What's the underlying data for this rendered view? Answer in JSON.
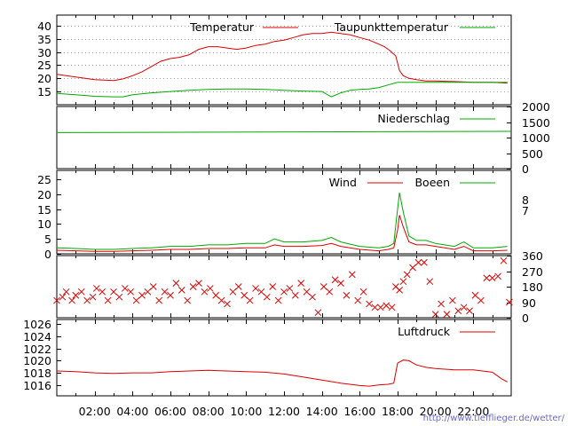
{
  "credit": "http://www.tiefflieger.de/wetter/",
  "time_ticks": [
    "02:00",
    "04:00",
    "06:00",
    "08:00",
    "10:00",
    "12:00",
    "14:00",
    "16:00",
    "18:00",
    "20:00",
    "22:00"
  ],
  "colors": {
    "red": "#dd0000",
    "green": "#00aa00",
    "grid": "#a0a0a0"
  },
  "chart_data": [
    {
      "type": "line",
      "panel": "temperature",
      "ylim": [
        10,
        44
      ],
      "yticks": [
        15,
        20,
        25,
        30,
        35,
        40
      ],
      "grid": true,
      "legend_position": "top",
      "series": [
        {
          "name": "Temperatur",
          "color": "#dd0000",
          "x": [
            0,
            1,
            1.5,
            2,
            3,
            3.5,
            4,
            4.5,
            5,
            5.5,
            6,
            6.5,
            7,
            7.5,
            8,
            8.5,
            9,
            9.5,
            10,
            10.5,
            11,
            11.5,
            12,
            12.5,
            13,
            13.5,
            14,
            14.5,
            15,
            15.5,
            16,
            16.5,
            17,
            17.3,
            17.6,
            17.9,
            18.1,
            18.3,
            18.6,
            19,
            19.5,
            20,
            21,
            22,
            23,
            23.8
          ],
          "values": [
            21.5,
            20.5,
            20,
            19.5,
            19.2,
            19.8,
            21,
            22.5,
            24.5,
            26.5,
            27.5,
            28,
            29,
            31,
            32,
            32,
            31.5,
            31,
            31.5,
            32.5,
            33,
            34,
            34.5,
            35.5,
            36.5,
            37,
            37,
            37.5,
            37,
            36.5,
            35.5,
            34.5,
            33,
            32,
            30.5,
            28.5,
            23,
            21,
            20,
            19.5,
            19,
            19,
            18.8,
            18.5,
            18.5,
            18.2
          ]
        },
        {
          "name": "Taupunkttemperatur",
          "color": "#00aa00",
          "x": [
            0,
            1,
            2,
            3,
            3.5,
            4,
            5,
            6,
            7,
            8,
            9,
            10,
            11,
            12,
            13,
            14,
            14.5,
            15,
            15.5,
            16,
            16.5,
            17,
            17.5,
            18,
            18.5,
            19,
            20,
            21,
            22,
            23,
            23.8
          ],
          "values": [
            14.3,
            13.8,
            13.2,
            13,
            13,
            13.8,
            14.5,
            15,
            15.5,
            15.8,
            16,
            16,
            15.8,
            15.5,
            15.2,
            15,
            13,
            14.5,
            15.5,
            15.8,
            16,
            16.5,
            17.5,
            18.5,
            18.5,
            18.5,
            18.5,
            18.5,
            18.5,
            18.5,
            18.5
          ]
        }
      ]
    },
    {
      "type": "line",
      "panel": "precipitation",
      "ylim": [
        0,
        2000
      ],
      "yticks": [
        0,
        500,
        1000,
        1500,
        2000
      ],
      "legend_position": "top-right",
      "series": [
        {
          "name": "Niederschlag",
          "color": "#00aa00",
          "x": [
            0,
            24
          ],
          "values": [
            1160,
            1200
          ]
        }
      ]
    },
    {
      "type": "line",
      "panel": "wind",
      "ylim": [
        0,
        28
      ],
      "yticks": [
        0,
        5,
        10,
        15,
        20,
        25
      ],
      "right_labels": [
        "8",
        "7"
      ],
      "legend_position": "top-right",
      "series": [
        {
          "name": "Wind",
          "color": "#dd0000",
          "x": [
            0,
            1,
            2,
            3,
            4,
            5,
            6,
            7,
            8,
            9,
            10,
            11,
            11.5,
            12,
            13,
            14,
            14.5,
            15,
            16,
            17,
            17.5,
            17.8,
            18,
            18.1,
            18.3,
            18.6,
            19,
            19.5,
            20,
            21,
            21.5,
            22,
            23,
            23.8
          ],
          "values": [
            1.2,
            1,
            0.8,
            0.8,
            1,
            1.2,
            1.5,
            1.5,
            1.8,
            1.8,
            2,
            2,
            3,
            2.5,
            2.5,
            2.8,
            3.5,
            2.5,
            1.5,
            1,
            1.5,
            2,
            8,
            13,
            9,
            4,
            3,
            3,
            2.5,
            1.5,
            2.5,
            1,
            1,
            1.2
          ]
        },
        {
          "name": "Boeen",
          "color": "#00aa00",
          "x": [
            0,
            1,
            2,
            3,
            4,
            5,
            6,
            7,
            8,
            9,
            10,
            11,
            11.5,
            12,
            13,
            14,
            14.5,
            15,
            16,
            17,
            17.5,
            17.8,
            18,
            18.1,
            18.3,
            18.6,
            19,
            19.5,
            20,
            21,
            21.5,
            22,
            23,
            23.8
          ],
          "values": [
            2,
            1.8,
            1.5,
            1.5,
            1.8,
            2,
            2.5,
            2.5,
            3,
            3,
            3.5,
            3.5,
            5,
            4,
            4,
            4.5,
            5.5,
            4,
            2.5,
            2,
            2.5,
            3.5,
            15,
            20.5,
            14,
            6,
            4.5,
            4.5,
            3.5,
            2.5,
            4,
            2,
            2,
            2.5
          ]
        }
      ]
    },
    {
      "type": "scatter",
      "panel": "wind_direction",
      "ylim": [
        0,
        360
      ],
      "yticks": [
        0,
        90,
        180,
        270,
        360
      ],
      "marker": "x",
      "series": [
        {
          "color": "#dd0000",
          "x": [
            0,
            0.3,
            0.5,
            0.8,
            1,
            1.3,
            1.6,
            1.9,
            2.1,
            2.4,
            2.7,
            3,
            3.3,
            3.6,
            3.9,
            4.2,
            4.5,
            4.8,
            5.1,
            5.4,
            5.7,
            6,
            6.3,
            6.6,
            6.9,
            7.2,
            7.5,
            7.8,
            8.1,
            8.4,
            8.7,
            9,
            9.3,
            9.6,
            9.9,
            10.2,
            10.5,
            10.8,
            11.1,
            11.4,
            11.7,
            12,
            12.3,
            12.6,
            12.9,
            13.2,
            13.5,
            13.8,
            14.1,
            14.4,
            14.7,
            15,
            15.3,
            15.6,
            15.9,
            16.2,
            16.5,
            16.8,
            17.1,
            17.4,
            17.7,
            17.9,
            18.1,
            18.3,
            18.5,
            18.8,
            19.1,
            19.4,
            19.7,
            20,
            20.3,
            20.6,
            20.9,
            21.2,
            21.5,
            21.8,
            22.1,
            22.4,
            22.7,
            23,
            23.3,
            23.6,
            23.9
          ],
          "values": [
            100,
            120,
            150,
            100,
            130,
            150,
            100,
            120,
            170,
            150,
            100,
            150,
            120,
            170,
            150,
            100,
            130,
            150,
            180,
            100,
            150,
            130,
            200,
            160,
            100,
            180,
            200,
            150,
            170,
            130,
            100,
            80,
            150,
            180,
            130,
            100,
            170,
            150,
            120,
            180,
            100,
            150,
            170,
            130,
            200,
            150,
            120,
            30,
            180,
            150,
            220,
            200,
            130,
            250,
            100,
            150,
            80,
            60,
            60,
            70,
            60,
            180,
            160,
            210,
            250,
            290,
            320,
            320,
            210,
            20,
            80,
            20,
            100,
            40,
            60,
            40,
            130,
            100,
            230,
            230,
            240,
            330,
            90
          ]
        }
      ]
    },
    {
      "type": "line",
      "panel": "pressure",
      "ylim": [
        1014.2,
        1026.8
      ],
      "yticks": [
        1016,
        1018,
        1020,
        1022,
        1024,
        1026
      ],
      "legend_position": "top-right",
      "series": [
        {
          "name": "Luftdruck",
          "color": "#dd0000",
          "x": [
            0,
            1,
            2,
            3,
            4,
            5,
            6,
            7,
            8,
            9,
            10,
            11,
            12,
            13,
            14,
            15,
            16,
            16.5,
            17,
            17.5,
            17.8,
            18,
            18.3,
            18.6,
            19,
            19.5,
            20,
            20.5,
            21,
            22,
            23,
            23.5,
            23.8
          ],
          "values": [
            1018.3,
            1018.2,
            1018,
            1017.9,
            1018,
            1018,
            1018.2,
            1018.3,
            1018.4,
            1018.3,
            1018.2,
            1018.1,
            1017.8,
            1017.3,
            1016.8,
            1016.3,
            1015.9,
            1015.8,
            1016.0,
            1016.1,
            1016.3,
            1019.6,
            1020.1,
            1020.0,
            1019.3,
            1018.9,
            1018.7,
            1018.6,
            1018.5,
            1018.5,
            1018.1,
            1017.0,
            1016.5
          ]
        }
      ]
    }
  ]
}
